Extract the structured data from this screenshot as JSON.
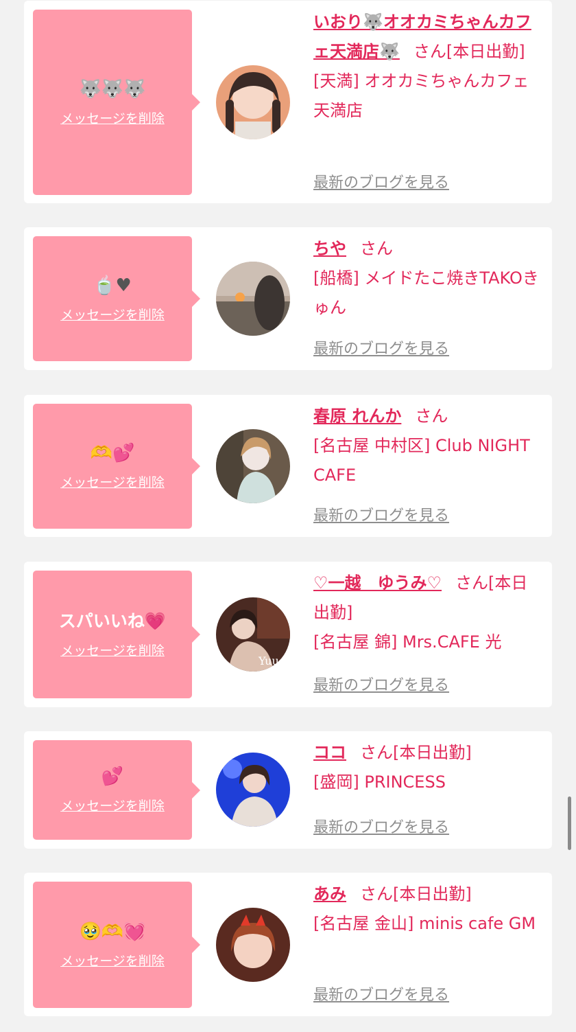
{
  "colors": {
    "background": "#f2f2f2",
    "bubble": "#ff9aaa",
    "name_pink": "#e2285a",
    "blog_gray": "#8e8e8e"
  },
  "delete_label": "メッセージを削除",
  "blog_label": "最新のブログを見る",
  "cards": [
    {
      "message": "🐺🐺🐺",
      "name": "いおり🐺オオカミちゃんカフェ天満店🐺",
      "suffix": "さん[本日出勤]",
      "shop": "[天満] オオカミちゃんカフェ天満店"
    },
    {
      "message": "🍵♥",
      "name": "ちや",
      "suffix": "さん",
      "shop": "[船橋] メイドたこ焼きTAKOきゅん"
    },
    {
      "message": "🫶💕",
      "name": "春原 れんか",
      "suffix": "さん",
      "shop": "[名古屋 中村区] Club NIGHT CAFE"
    },
    {
      "message": "スパいいね💗",
      "name": "♡一越　ゆうみ♡",
      "suffix": "さん[本日出勤]",
      "shop": "[名古屋 錦] Mrs.CAFE 光"
    },
    {
      "message": "💕",
      "name": "ココ",
      "suffix": "さん[本日出勤]",
      "shop": "[盛岡] PRINCESS"
    },
    {
      "message": "🥹🫶💓",
      "name": "あみ",
      "suffix": "さん[本日出勤]",
      "shop": "[名古屋 金山] minis cafe GM"
    }
  ]
}
